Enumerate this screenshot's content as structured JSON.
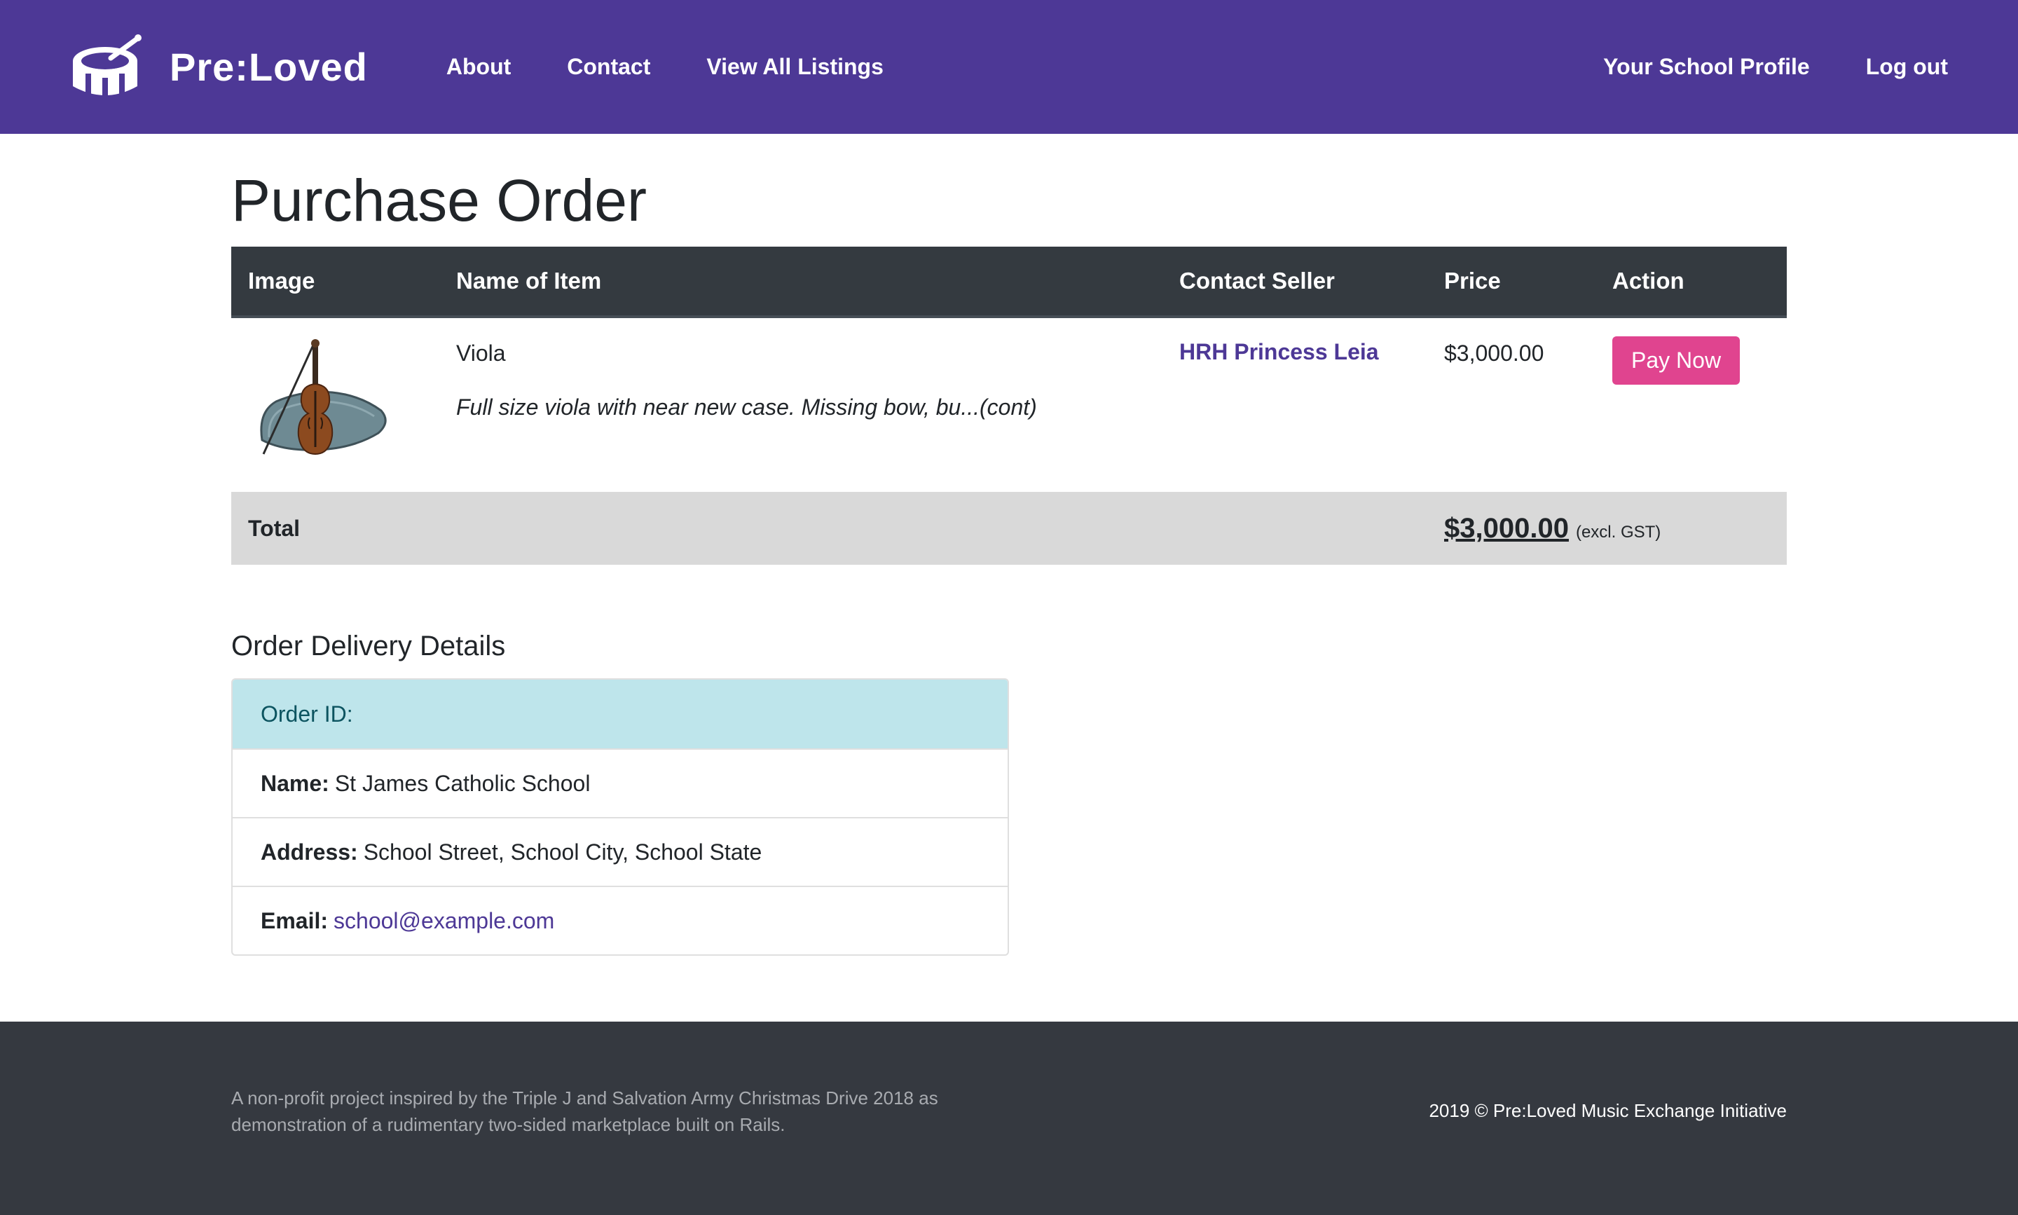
{
  "nav": {
    "brand": "Pre:Loved",
    "links_left": [
      "About",
      "Contact",
      "View All Listings"
    ],
    "links_right": [
      "Your School Profile",
      "Log out"
    ],
    "brand_color": "#4d3896"
  },
  "page": {
    "title": "Purchase Order"
  },
  "table": {
    "headers": [
      "Image",
      "Name of Item",
      "Contact Seller",
      "Price",
      "Action"
    ],
    "item": {
      "image": "viola-with-case",
      "name": "Viola",
      "description": "Full size viola with near new case. Missing bow, bu...(cont)",
      "seller": "HRH Princess Leia",
      "price": "$3,000.00",
      "action": "Pay Now"
    },
    "total": {
      "label": "Total",
      "amount": "$3,000.00",
      "note": "(excl. GST)"
    }
  },
  "delivery": {
    "title": "Order Delivery Details",
    "order_id_label": "Order ID:",
    "name_label": "Name:",
    "name_value": "St James Catholic School",
    "address_label": "Address:",
    "address_value": "School Street, School City, School State",
    "email_label": "Email:",
    "email_value": "school@example.com"
  },
  "footer": {
    "description": "A non-profit project inspired by the Triple J and Salvation Army Christmas Drive 2018 as demonstration of a rudimentary two-sided marketplace built on Rails.",
    "copyright": "2019 © Pre:Loved Music Exchange Initiative"
  },
  "colors": {
    "navbar": "#4d3896",
    "table_header": "#343a40",
    "pay_button": "#e0448f",
    "info_row": "#bee5eb",
    "footer": "#353940"
  }
}
